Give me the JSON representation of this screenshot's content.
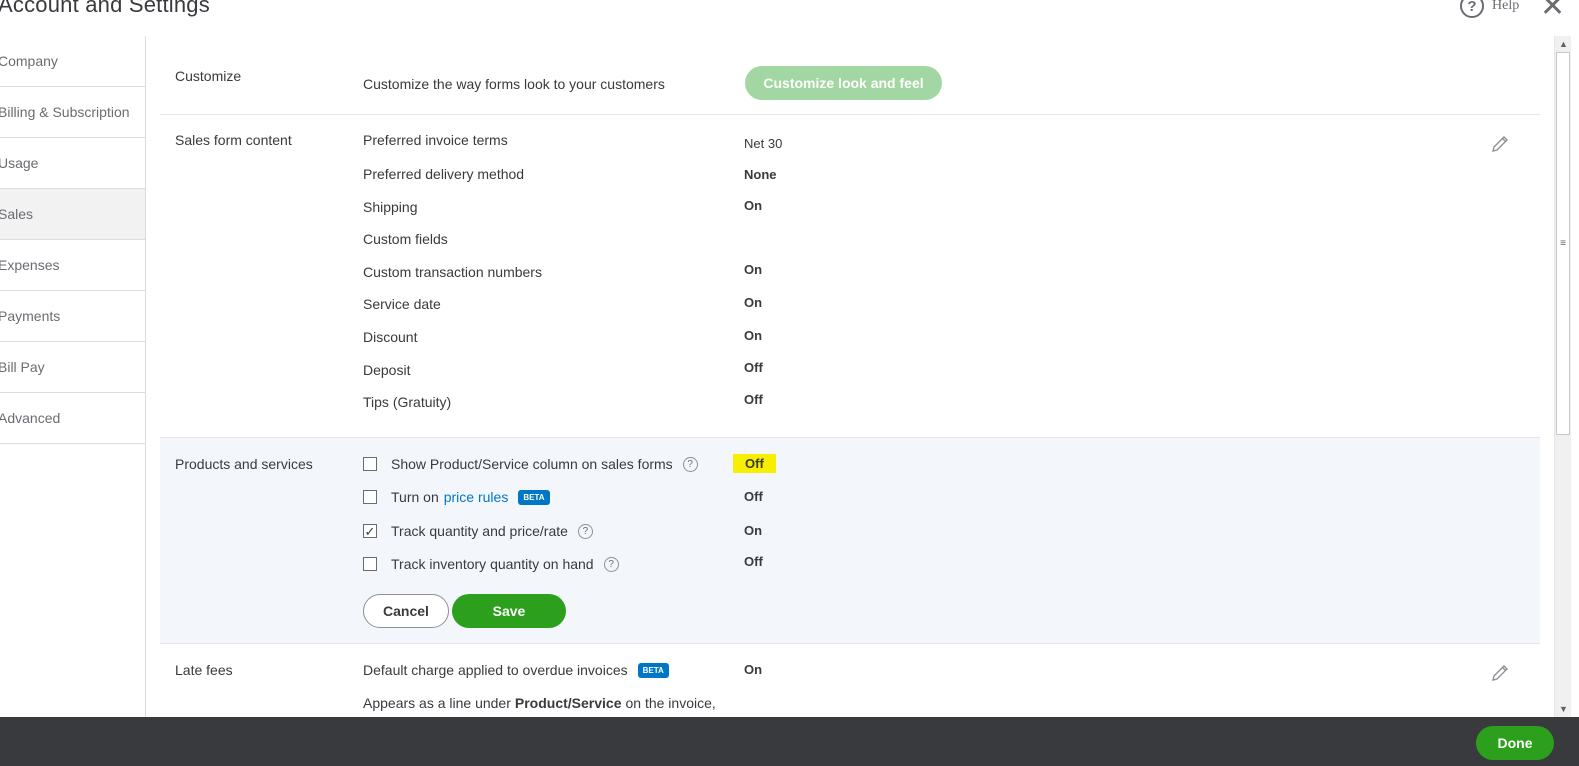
{
  "header": {
    "title": "Account and Settings",
    "help_label": "Help",
    "close_glyph": "✕"
  },
  "sidebar": {
    "items": [
      {
        "label": "Company"
      },
      {
        "label": "Billing & Subscription"
      },
      {
        "label": "Usage"
      },
      {
        "label": "Sales",
        "active": true
      },
      {
        "label": "Expenses"
      },
      {
        "label": "Payments"
      },
      {
        "label": "Bill Pay"
      },
      {
        "label": "Advanced"
      }
    ]
  },
  "customize": {
    "label": "Customize",
    "description": "Customize the way forms look to your customers",
    "button_label": "Customize look and feel"
  },
  "sales_form_content": {
    "label": "Sales form content",
    "rows": [
      {
        "label": "Preferred invoice terms",
        "value": "Net 30"
      },
      {
        "label": "Preferred delivery method",
        "value": "None"
      },
      {
        "label": "Shipping",
        "value": "On"
      },
      {
        "label": "Custom fields",
        "value": ""
      },
      {
        "label": "Custom transaction numbers",
        "value": "On"
      },
      {
        "label": "Service date",
        "value": "On"
      },
      {
        "label": "Discount",
        "value": "On"
      },
      {
        "label": "Deposit",
        "value": "Off"
      },
      {
        "label": "Tips (Gratuity)",
        "value": "Off"
      }
    ]
  },
  "products_services": {
    "label": "Products and services",
    "show_column": {
      "label": "Show Product/Service column on sales forms",
      "checked": false,
      "value": "Off"
    },
    "price_rules": {
      "prefix": "Turn on",
      "link": "price rules",
      "badge": "BETA",
      "checked": false,
      "value": "Off"
    },
    "track_qty": {
      "label": "Track quantity and price/rate",
      "checked": true,
      "value": "On"
    },
    "track_inventory": {
      "label": "Track inventory quantity on hand",
      "checked": false,
      "value": "Off"
    },
    "cancel_label": "Cancel",
    "save_label": "Save"
  },
  "late_fees": {
    "label": "Late fees",
    "row_label": "Default charge applied to overdue invoices",
    "badge": "BETA",
    "value": "On",
    "desc_prefix": "Appears as a line under",
    "desc_bold": "Product/Service",
    "desc_suffix": "on the invoice,"
  },
  "icons": {
    "check": "✓",
    "info": "?",
    "help": "?",
    "scroll_up": "▲",
    "scroll_down": "▼",
    "grip": "≡"
  },
  "footer": {
    "done_label": "Done"
  },
  "colors": {
    "accent_green": "#2ca01c",
    "light_green": "#a2d6a2",
    "link_blue": "#0077c5",
    "highlight": "#f7ee00",
    "footer_bg": "#393a3d"
  }
}
